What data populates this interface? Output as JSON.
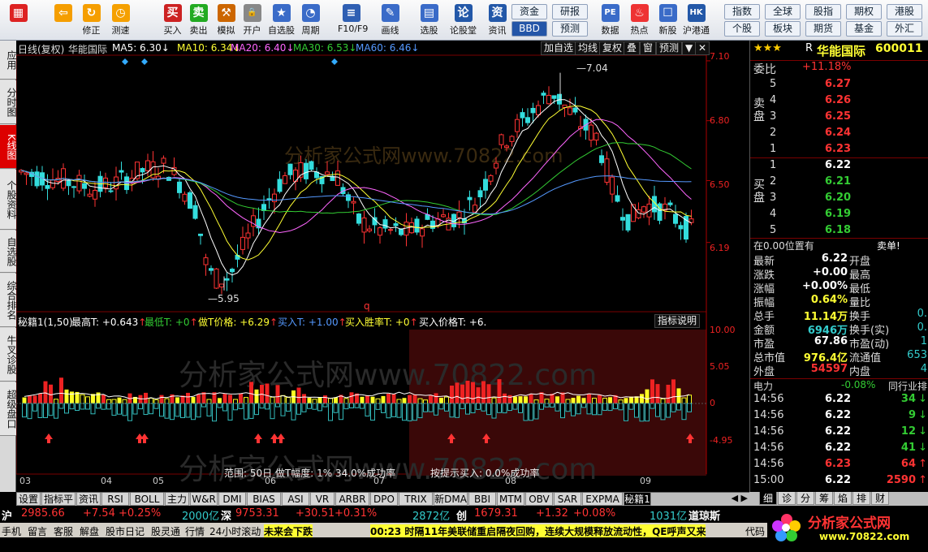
{
  "toolbar": {
    "buttons": [
      {
        "label": "",
        "icon": "window-icon"
      },
      {
        "label": "",
        "icon": "back-arrow-icon"
      },
      {
        "label": "修正",
        "icon": "refresh-icon"
      },
      {
        "label": "测速",
        "icon": "speed-icon"
      },
      {
        "label": "买入",
        "icon": "buy-icon"
      },
      {
        "label": "卖出",
        "icon": "sell-icon"
      },
      {
        "label": "模拟",
        "icon": "hammer-icon"
      },
      {
        "label": "开户",
        "icon": "lock-icon"
      },
      {
        "label": "自选股",
        "icon": "star-icon"
      },
      {
        "label": "周期",
        "icon": "clock-icon"
      },
      {
        "label": "F10/F9",
        "icon": "f10-icon"
      },
      {
        "label": "画线",
        "icon": "pen-icon"
      },
      {
        "label": "选股",
        "icon": "screen-icon"
      },
      {
        "label": "论股堂",
        "icon": "forum-icon"
      },
      {
        "label": "资讯",
        "icon": "news-icon"
      },
      {
        "label": "数据",
        "icon": "pe-icon"
      },
      {
        "label": "热点",
        "icon": "hot-icon"
      },
      {
        "label": "新股",
        "icon": "newstock-icon"
      },
      {
        "label": "沪港通",
        "icon": "hk-icon"
      }
    ],
    "mid_buttons": [
      "资金",
      "研报",
      "BBD",
      "预测"
    ],
    "market_buttons": [
      "指数",
      "全球",
      "股指",
      "期权",
      "港股",
      "个股",
      "板块",
      "期货",
      "基金",
      "外汇"
    ],
    "bbd_label": "BBD"
  },
  "left_tabs": [
    "应用",
    "分时图",
    "K线图",
    "个股资料",
    "自选股",
    "综合排名",
    "牛叉诊股",
    "超级盘口"
  ],
  "chart": {
    "period_label": "日线(复权)",
    "stock_name": "华能国际",
    "ma": [
      {
        "label": "MA5: 6.30",
        "color": "#ffffff"
      },
      {
        "label": "MA10: 6.34",
        "color": "#ffff33"
      },
      {
        "label": "MA20: 6.40",
        "color": "#ff66ff"
      },
      {
        "label": "MA30: 6.53",
        "color": "#33cc33"
      },
      {
        "label": "MA60: 6.46",
        "color": "#5599ff"
      }
    ],
    "top_buttons": [
      "加自选",
      "均线",
      "复权",
      "叠",
      "窗",
      "预测"
    ],
    "watermark": "分析家公式网www.70822.com",
    "price_labels": {
      "high": "7.04",
      "low": "5.95"
    },
    "indicator": {
      "name": "秘籍1(1,50)",
      "items": [
        {
          "label": "最高T: +0.643",
          "color": "#ffffff"
        },
        {
          "label": "最低T: +0",
          "color": "#33cc33"
        },
        {
          "label": "做T价格: +6.29",
          "color": "#ffff33"
        },
        {
          "label": "买入T: +1.00",
          "color": "#5599ff"
        },
        {
          "label": "买入胜率T: +0",
          "color": "#ffff33"
        },
        {
          "label": "买入价格T: +6.0",
          "color": "#ffffff"
        }
      ],
      "help_button": "指标说明",
      "range_text": "范围: 50日 做T幅度: 1% 34.0%成功率",
      "hint_text": "按提示买入: 0.0%成功率",
      "ticks": [
        "10.00",
        "5.05",
        "0",
        "-4.95"
      ]
    },
    "price_ticks": [
      "7.10",
      "6.80",
      "6.50",
      "6.19"
    ],
    "x_labels": [
      "03",
      "04",
      "05",
      "06",
      "07",
      "08",
      "09"
    ],
    "q_marker": "q"
  },
  "chart_data": {
    "type": "candlestick",
    "title": "华能国际",
    "ylim": [
      5.9,
      7.12
    ],
    "x": [
      "03",
      "04",
      "05",
      "06",
      "07",
      "08",
      "09"
    ],
    "annotated_high": 7.04,
    "annotated_low": 5.95,
    "ma_values": {
      "MA5": 6.3,
      "MA10": 6.34,
      "MA20": 6.4,
      "MA30": 6.53,
      "MA60": 6.46
    }
  },
  "quote": {
    "stars": "★★★",
    "prefix": "R",
    "name": "华能国际",
    "code": "600011",
    "weibi_label": "委比",
    "weibi_value": "+11.18%",
    "sell_label": "卖盘",
    "buy_label": "买盘",
    "sells": [
      {
        "n": "5",
        "p": "6.27"
      },
      {
        "n": "4",
        "p": "6.26"
      },
      {
        "n": "3",
        "p": "6.25"
      },
      {
        "n": "2",
        "p": "6.24"
      },
      {
        "n": "1",
        "p": "6.23"
      }
    ],
    "buys": [
      {
        "n": "1",
        "p": "6.22"
      },
      {
        "n": "2",
        "p": "6.21"
      },
      {
        "n": "3",
        "p": "6.20"
      },
      {
        "n": "4",
        "p": "6.19"
      },
      {
        "n": "5",
        "p": "6.18"
      }
    ],
    "position_text": "在0.00位置有",
    "sell_single": "卖单!",
    "stats_left": [
      {
        "l": "最新",
        "v": "6.22",
        "c": "#ffffff"
      },
      {
        "l": "涨跌",
        "v": "+0.00",
        "c": "#ffffff"
      },
      {
        "l": "涨幅",
        "v": "+0.00%",
        "c": "#ffffff"
      },
      {
        "l": "振幅",
        "v": "0.64%",
        "c": "#ffff33"
      },
      {
        "l": "总手",
        "v": "11.14万",
        "c": "#ffff33"
      },
      {
        "l": "金额",
        "v": "6946万",
        "c": "#33cccc"
      },
      {
        "l": "市盈",
        "v": "67.86",
        "c": "#ffffff"
      },
      {
        "l": "总市值",
        "v": "976.4亿",
        "c": "#ffff33"
      },
      {
        "l": "外盘",
        "v": "54597",
        "c": "#ff3333"
      }
    ],
    "stats_right": [
      {
        "l": "开盘",
        "v": ""
      },
      {
        "l": "最高",
        "v": ""
      },
      {
        "l": "最低",
        "v": ""
      },
      {
        "l": "量比",
        "v": ""
      },
      {
        "l": "换手",
        "v": "0."
      },
      {
        "l": "换手(实)",
        "v": "0."
      },
      {
        "l": "市盈(动)",
        "v": "1"
      },
      {
        "l": "流通值",
        "v": "653"
      },
      {
        "l": "内盘",
        "v": "4"
      }
    ],
    "industry_label": "电力",
    "industry_change": "-0.08%",
    "industry_rank": "同行业排",
    "ticks": [
      {
        "t": "14:56",
        "p": "6.22",
        "v": "34",
        "c": "#33cc33"
      },
      {
        "t": "14:56",
        "p": "6.22",
        "v": "9",
        "c": "#33cc33"
      },
      {
        "t": "14:56",
        "p": "6.22",
        "v": "12",
        "c": "#33cc33"
      },
      {
        "t": "14:56",
        "p": "6.22",
        "v": "41",
        "c": "#33cc33"
      },
      {
        "t": "14:56",
        "p": "6.23",
        "v": "64",
        "c": "#ff3333"
      },
      {
        "t": "15:00",
        "p": "6.22",
        "v": "2590",
        "c": "#ff3333"
      }
    ]
  },
  "bottom_tabs": [
    "设置",
    "指标平台",
    "资讯",
    "RSI",
    "BOLL",
    "主力",
    "W&R",
    "DMI",
    "BIAS",
    "ASI",
    "VR",
    "ARBR",
    "DPO",
    "TRIX",
    "新DMA",
    "BBI",
    "MTM",
    "OBV",
    "SAR",
    "EXPMA",
    "秘籍1"
  ],
  "right_tabs": [
    "细",
    "诊",
    "分",
    "筹",
    "焰",
    "排",
    "财"
  ],
  "index_bar": [
    {
      "t": "沪",
      "c": "#ffffff"
    },
    {
      "t": "2985.66",
      "c": "#ff3333"
    },
    {
      "t": "+7.54",
      "c": "#ff3333"
    },
    {
      "t": "+0.25%",
      "c": "#ff3333"
    },
    {
      "t": "2000亿",
      "c": "#33cccc"
    },
    {
      "t": "深",
      "c": "#ffffff"
    },
    {
      "t": "9753.31",
      "c": "#ff3333"
    },
    {
      "t": "+30.51",
      "c": "#ff3333"
    },
    {
      "t": "+0.31%",
      "c": "#ff3333"
    },
    {
      "t": "2872亿",
      "c": "#33cccc"
    },
    {
      "t": "创",
      "c": "#ffffff"
    },
    {
      "t": "1679.31",
      "c": "#ff3333"
    },
    {
      "t": "+1.32",
      "c": "#ff3333"
    },
    {
      "t": "+0.08%",
      "c": "#ff3333"
    },
    {
      "t": "1031亿",
      "c": "#33cccc"
    },
    {
      "t": "道琼斯",
      "c": "#ffffff"
    }
  ],
  "news_bar": {
    "links": [
      "手机",
      "留言",
      "客服",
      "解盘",
      "股市日记",
      "股灵通",
      "行情",
      "24小时滚动"
    ],
    "headline1": "未来会下跌",
    "headline2": "00:23 时隔11年美联储重启隔夜回购，连续大规模释放流动性，QE呼声又来",
    "right": "代码"
  },
  "logo": {
    "text": "分析家公式网",
    "url": "www.70822.com"
  }
}
